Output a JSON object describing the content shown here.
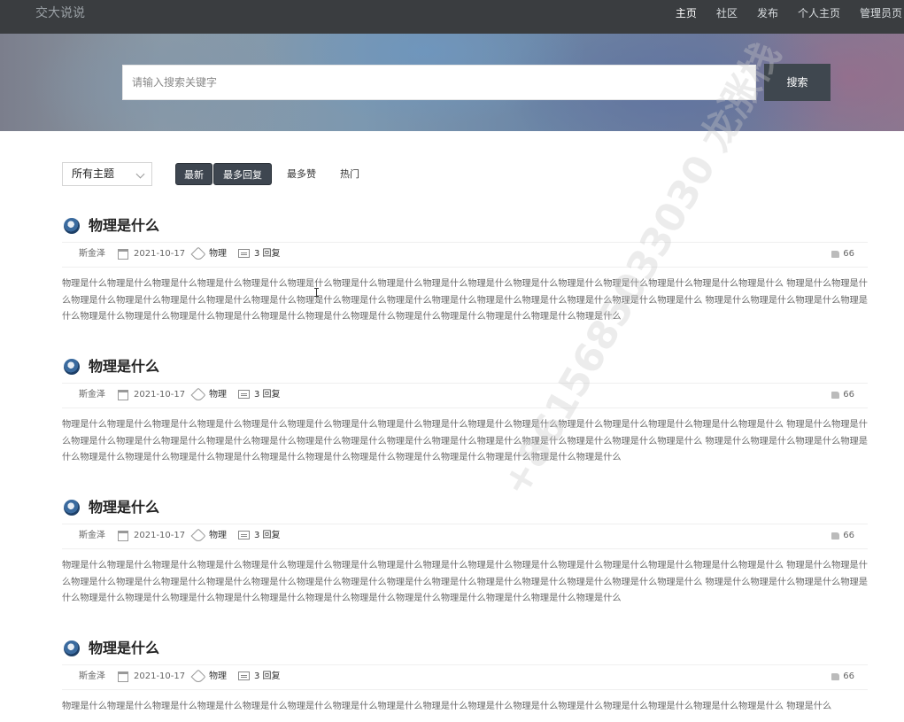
{
  "navbar": {
    "brand": "交大说说",
    "links": [
      "主页",
      "社区",
      "发布",
      "个人主页",
      "管理员页"
    ]
  },
  "search": {
    "placeholder": "请输入搜索关键字",
    "button_label": "搜索"
  },
  "filters": {
    "topic_selected": "所有主题",
    "sort_tabs": [
      "最新",
      "最多回复",
      "最多赞",
      "热门"
    ],
    "active_tabs": [
      "最新",
      "最多回复"
    ]
  },
  "posts": [
    {
      "title": "物理是什么",
      "author": "斯金泽",
      "date": "2021-10-17",
      "tag": "物理",
      "replies": "3 回复",
      "likes": "66",
      "excerpt": "物理是什么物理是什么物理是什么物理是什么物理是什么物理是什么物理是什么物理是什么物理是什么物理是什么物理是什么物理是什么物理是什么物理是什么物理是什么物理是什么 物理是什么物理是什么物理是什么物理是什么物理是什么物理是什么物理是什么物理是什么物理是什么物理是什么物理是什么物理是什么物理是什么物理是什么物理是什么物理是什么 物理是什么物理是什么物理是什么物理是什么物理是什么物理是什么物理是什么物理是什么物理是什么物理是什么物理是什么物理是什么物理是什么物理是什么物理是什么物理是什么"
    },
    {
      "title": "物理是什么",
      "author": "斯金泽",
      "date": "2021-10-17",
      "tag": "物理",
      "replies": "3 回复",
      "likes": "66",
      "excerpt": "物理是什么物理是什么物理是什么物理是什么物理是什么物理是什么物理是什么物理是什么物理是什么物理是什么物理是什么物理是什么物理是什么物理是什么物理是什么物理是什么 物理是什么物理是什么物理是什么物理是什么物理是什么物理是什么物理是什么物理是什么物理是什么物理是什么物理是什么物理是什么物理是什么物理是什么物理是什么物理是什么 物理是什么物理是什么物理是什么物理是什么物理是什么物理是什么物理是什么物理是什么物理是什么物理是什么物理是什么物理是什么物理是什么物理是什么物理是什么物理是什么"
    },
    {
      "title": "物理是什么",
      "author": "斯金泽",
      "date": "2021-10-17",
      "tag": "物理",
      "replies": "3 回复",
      "likes": "66",
      "excerpt": "物理是什么物理是什么物理是什么物理是什么物理是什么物理是什么物理是什么物理是什么物理是什么物理是什么物理是什么物理是什么物理是什么物理是什么物理是什么物理是什么 物理是什么物理是什么物理是什么物理是什么物理是什么物理是什么物理是什么物理是什么物理是什么物理是什么物理是什么物理是什么物理是什么物理是什么物理是什么物理是什么 物理是什么物理是什么物理是什么物理是什么物理是什么物理是什么物理是什么物理是什么物理是什么物理是什么物理是什么物理是什么物理是什么物理是什么物理是什么物理是什么"
    },
    {
      "title": "物理是什么",
      "author": "斯金泽",
      "date": "2021-10-17",
      "tag": "物理",
      "replies": "3 回复",
      "likes": "66",
      "excerpt": "物理是什么物理是什么物理是什么物理是什么物理是什么物理是什么物理是什么物理是什么物理是什么物理是什么物理是什么物理是什么物理是什么物理是什么物理是什么物理是什么 物理是什么"
    }
  ],
  "watermark": "+8615685033030 龙涨栈"
}
